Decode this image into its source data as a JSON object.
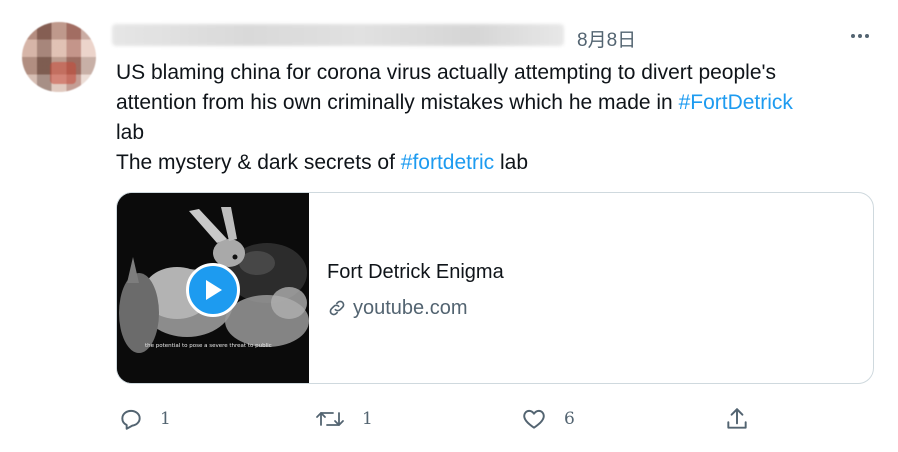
{
  "tweet": {
    "timestamp": "8月8日",
    "more_icon": "more-horizontal-icon",
    "text_lines": [
      {
        "segments": [
          {
            "text": "US blaming china for corona virus actually  attempting to divert people's",
            "hashtag": false
          }
        ]
      },
      {
        "segments": [
          {
            "text": "attention from his own criminally mistakes which he made in ",
            "hashtag": false
          },
          {
            "text": "#FortDetrick",
            "hashtag": true
          }
        ]
      },
      {
        "segments": [
          {
            "text": "lab",
            "hashtag": false
          }
        ]
      },
      {
        "segments": [
          {
            "text": "The mystery & dark secrets of ",
            "hashtag": false
          },
          {
            "text": "#fortdetric",
            "hashtag": true
          },
          {
            "text": " lab",
            "hashtag": false
          }
        ]
      }
    ],
    "hashtag_color": "#1d9bf0"
  },
  "card": {
    "title": "Fort Detrick Enigma",
    "domain": "youtube.com",
    "thumbnail_caption": "the potential to pose a severe threat to public",
    "play_icon": "play-icon",
    "link_icon": "link-icon",
    "play_color": "#1d9bf0"
  },
  "actions": {
    "reply": {
      "icon": "reply-icon",
      "count": "1"
    },
    "retweet": {
      "icon": "retweet-icon",
      "count": "1"
    },
    "like": {
      "icon": "heart-icon",
      "count": "6"
    },
    "share": {
      "icon": "share-icon"
    }
  }
}
